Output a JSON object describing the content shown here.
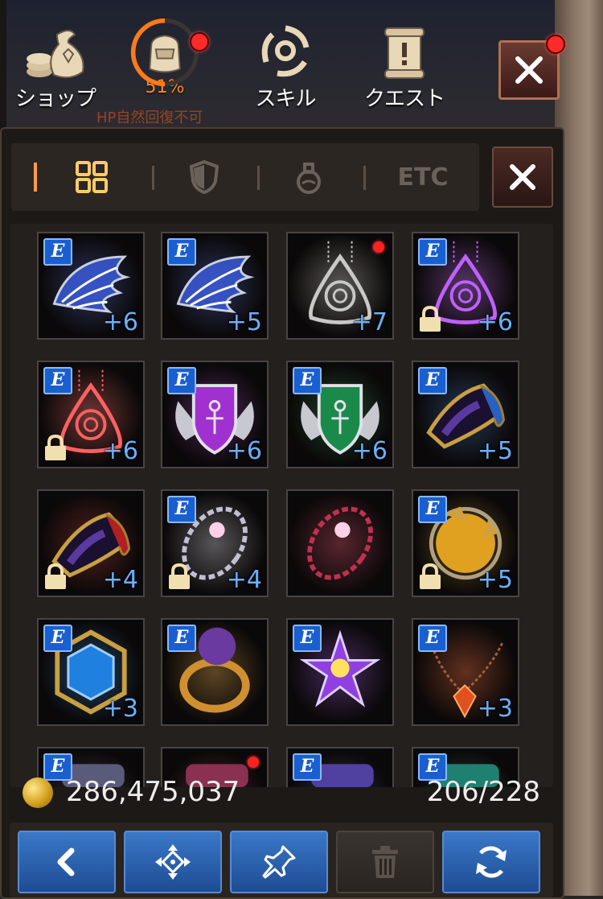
{
  "topbar": {
    "shop_label": "ショップ",
    "bag_percent": "51%",
    "hp_notice": "HP自然回復不可",
    "skill_label": "スキル",
    "quest_label": "クエスト"
  },
  "tabs": {
    "etc_label": "ETC"
  },
  "inventory": {
    "items": [
      {
        "enhance": "+6",
        "badge": "E",
        "kind": "wing",
        "color": "#3a5ad8",
        "locked": false,
        "dot": false
      },
      {
        "enhance": "+5",
        "badge": "E",
        "kind": "wing",
        "color": "#3a5ad8",
        "locked": false,
        "dot": false
      },
      {
        "enhance": "+7",
        "badge": "",
        "kind": "earring",
        "color": "#c8c8c8",
        "locked": false,
        "dot": true
      },
      {
        "enhance": "+6",
        "badge": "E",
        "kind": "earring",
        "color": "#c060ff",
        "locked": true,
        "dot": false
      },
      {
        "enhance": "+6",
        "badge": "E",
        "kind": "earring",
        "color": "#ff6060",
        "locked": true,
        "dot": false
      },
      {
        "enhance": "+6",
        "badge": "E",
        "kind": "shield",
        "color": "#a030d0",
        "locked": false,
        "dot": false
      },
      {
        "enhance": "+6",
        "badge": "E",
        "kind": "shield",
        "color": "#1a8a4a",
        "locked": false,
        "dot": false
      },
      {
        "enhance": "+5",
        "badge": "E",
        "kind": "bracer",
        "color": "#2a60c0",
        "locked": false,
        "dot": false
      },
      {
        "enhance": "+4",
        "badge": "",
        "kind": "bracer",
        "color": "#b02020",
        "locked": true,
        "dot": false
      },
      {
        "enhance": "+4",
        "badge": "E",
        "kind": "bracelet",
        "color": "#c0c0d0",
        "locked": true,
        "dot": false
      },
      {
        "enhance": "",
        "badge": "",
        "kind": "bracelet",
        "color": "#c03050",
        "locked": false,
        "dot": false
      },
      {
        "enhance": "+5",
        "badge": "E",
        "kind": "orb",
        "color": "#e0a020",
        "locked": true,
        "dot": false
      },
      {
        "enhance": "+3",
        "badge": "E",
        "kind": "gem",
        "color": "#2080e0",
        "locked": false,
        "dot": false
      },
      {
        "enhance": "",
        "badge": "E",
        "kind": "ring",
        "color": "#d09030",
        "locked": false,
        "dot": false
      },
      {
        "enhance": "",
        "badge": "E",
        "kind": "star",
        "color": "#9040e0",
        "locked": false,
        "dot": false
      },
      {
        "enhance": "+3",
        "badge": "E",
        "kind": "necklace",
        "color": "#e05020",
        "locked": false,
        "dot": false
      },
      {
        "enhance": "",
        "badge": "E",
        "kind": "partial",
        "color": "#5a5a7a",
        "locked": false,
        "dot": false
      },
      {
        "enhance": "",
        "badge": "",
        "kind": "partial",
        "color": "#8a3050",
        "locked": false,
        "dot": true
      },
      {
        "enhance": "",
        "badge": "E",
        "kind": "partial",
        "color": "#5040a0",
        "locked": false,
        "dot": false
      },
      {
        "enhance": "",
        "badge": "E",
        "kind": "partial",
        "color": "#208070",
        "locked": false,
        "dot": false
      }
    ]
  },
  "footer": {
    "gold": "286,475,037",
    "capacity": "206/228"
  },
  "icons": [
    "shop-icon",
    "bag-icon",
    "skill-icon",
    "quest-icon",
    "close-icon",
    "equipment-tab-icon",
    "all-items-icon",
    "armor-tab-icon",
    "potion-tab-icon",
    "coin-icon",
    "back-icon",
    "move-icon",
    "pin-icon",
    "trash-icon",
    "refresh-icon",
    "lock-icon"
  ]
}
